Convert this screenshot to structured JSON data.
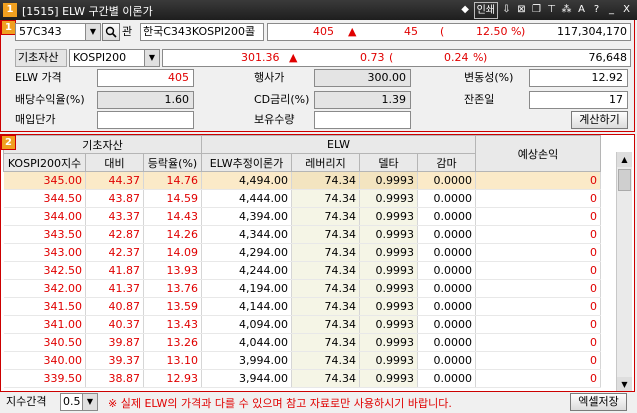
{
  "titlebar": {
    "badge": "1",
    "title": "[1515] ELW 구간별 이론가",
    "tools": [
      "◆",
      "인쇄",
      "⇩",
      "⊠",
      "❐",
      "⊤",
      "⁂",
      "A",
      "?",
      "_",
      "X"
    ]
  },
  "panel1_marker": "1",
  "panel2_marker": "2",
  "search": {
    "code": "57C343",
    "search_icon": "search-icon",
    "ne_label": "관",
    "name": "한국C343KOSPI200콜"
  },
  "quote": {
    "price": "405",
    "arrow": "▲",
    "change": "45",
    "paren_open": "(",
    "pct": "12.50",
    "pct_sign": "%",
    "paren_close": ")",
    "volume": "117,304,170"
  },
  "underlying": {
    "label": "기초자산",
    "value": "KOSPI200",
    "price": "301.36",
    "arrow": "▲",
    "change": "0.73",
    "paren_open": "(",
    "pct": "0.24",
    "pct_sign": "%",
    "paren_close": ")",
    "volume": "76,648"
  },
  "params": {
    "elw_price_label": "ELW 가격",
    "elw_price": "405",
    "strike_label": "행사가",
    "strike": "300.00",
    "vol_label": "변동성(%)",
    "vol": "12.92",
    "div_label": "배당수익율(%)",
    "div": "1.60",
    "cd_label": "CD금리(%)",
    "cd": "1.39",
    "remain_label": "잔존일",
    "remain": "17",
    "buy_label": "매입단가",
    "buy": "",
    "qty_label": "보유수량",
    "qty": "",
    "calc_button": "계산하기"
  },
  "table": {
    "group_underlying": "기초자산",
    "group_elw": "ELW",
    "headers": [
      "KOSPI200지수",
      "대비",
      "등락율(%)",
      "ELW추정이론가",
      "레버리지",
      "델타",
      "감마",
      "예상손익"
    ],
    "rows": [
      [
        "345.00",
        "44.37",
        "14.76",
        "4,494.00",
        "74.34",
        "0.9993",
        "0.0000",
        "0"
      ],
      [
        "344.50",
        "43.87",
        "14.59",
        "4,444.00",
        "74.34",
        "0.9993",
        "0.0000",
        "0"
      ],
      [
        "344.00",
        "43.37",
        "14.43",
        "4,394.00",
        "74.34",
        "0.9993",
        "0.0000",
        "0"
      ],
      [
        "343.50",
        "42.87",
        "14.26",
        "4,344.00",
        "74.34",
        "0.9993",
        "0.0000",
        "0"
      ],
      [
        "343.00",
        "42.37",
        "14.09",
        "4,294.00",
        "74.34",
        "0.9993",
        "0.0000",
        "0"
      ],
      [
        "342.50",
        "41.87",
        "13.93",
        "4,244.00",
        "74.34",
        "0.9993",
        "0.0000",
        "0"
      ],
      [
        "342.00",
        "41.37",
        "13.76",
        "4,194.00",
        "74.34",
        "0.9993",
        "0.0000",
        "0"
      ],
      [
        "341.50",
        "40.87",
        "13.59",
        "4,144.00",
        "74.34",
        "0.9993",
        "0.0000",
        "0"
      ],
      [
        "341.00",
        "40.37",
        "13.43",
        "4,094.00",
        "74.34",
        "0.9993",
        "0.0000",
        "0"
      ],
      [
        "340.50",
        "39.87",
        "13.26",
        "4,044.00",
        "74.34",
        "0.9993",
        "0.0000",
        "0"
      ],
      [
        "340.00",
        "39.37",
        "13.10",
        "3,994.00",
        "74.34",
        "0.9993",
        "0.0000",
        "0"
      ],
      [
        "339.50",
        "38.87",
        "12.93",
        "3,944.00",
        "74.34",
        "0.9993",
        "0.0000",
        "0"
      ]
    ]
  },
  "bottom": {
    "interval_label": "지수간격",
    "interval": "0.5",
    "warning": "※ 실제 ELW의 가격과 다를 수 있으며 참고 자료로만 사용하시기 바랍니다.",
    "excel_button": "엑셀저장"
  },
  "colors": {
    "up": "#e00000",
    "accent": "#f0a020",
    "panel_border": "#cc0000"
  }
}
